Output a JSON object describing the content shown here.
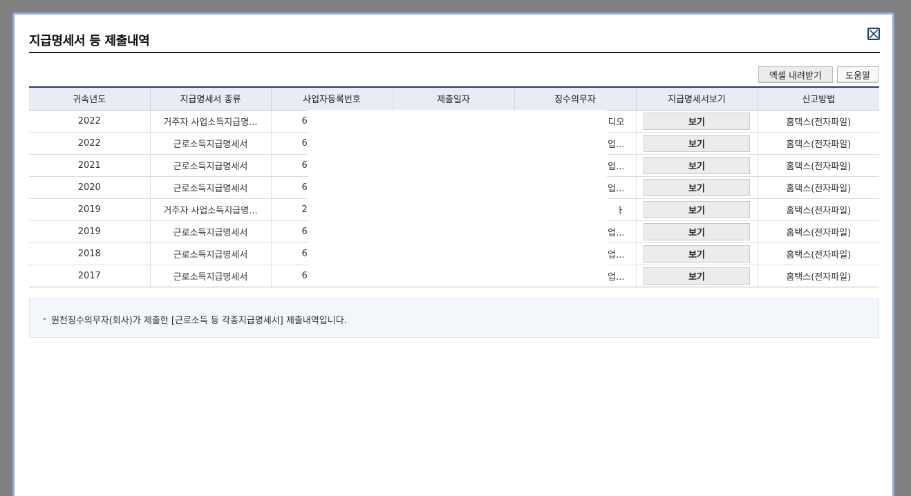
{
  "dialog": {
    "title": "지급명세서 등 제출내역",
    "excel_button": "엑셀 내려받기",
    "help_button": "도움말"
  },
  "table": {
    "headers": [
      "귀속년도",
      "지급명세서 종류",
      "사업자등록번호",
      "제출일자",
      "징수의무자",
      "지급명세서보기",
      "신고방법"
    ],
    "rows": [
      {
        "year": "2022",
        "type": "거주자 사업소득지급명...",
        "bizno": "6",
        "date": "",
        "payer": "디오",
        "view": "보기",
        "method": "홈택스(전자파일)"
      },
      {
        "year": "2022",
        "type": "근로소득지급명세서",
        "bizno": "6",
        "date": "",
        "payer": "업...",
        "view": "보기",
        "method": "홈택스(전자파일)"
      },
      {
        "year": "2021",
        "type": "근로소득지급명세서",
        "bizno": "6",
        "date": "",
        "payer": "업...",
        "view": "보기",
        "method": "홈택스(전자파일)"
      },
      {
        "year": "2020",
        "type": "근로소득지급명세서",
        "bizno": "6",
        "date": "",
        "payer": "업...",
        "view": "보기",
        "method": "홈택스(전자파일)"
      },
      {
        "year": "2019",
        "type": "거주자 사업소득지급명...",
        "bizno": "2",
        "date": "",
        "payer": "ㅏ",
        "view": "보기",
        "method": "홈택스(전자파일)"
      },
      {
        "year": "2019",
        "type": "근로소득지급명세서",
        "bizno": "6",
        "date": "",
        "payer": "업...",
        "view": "보기",
        "method": "홈택스(전자파일)"
      },
      {
        "year": "2018",
        "type": "근로소득지급명세서",
        "bizno": "6",
        "date": "",
        "payer": "업...",
        "view": "보기",
        "method": "홈택스(전자파일)"
      },
      {
        "year": "2017",
        "type": "근로소득지급명세서",
        "bizno": "6",
        "date": "",
        "payer": "업...",
        "view": "보기",
        "method": "홈택스(전자파일)"
      }
    ]
  },
  "notice": {
    "text": "원천징수의무자(회사)가 제출한 [근로소득 등 각종지급명세서] 제출내역입니다."
  },
  "colors": {
    "accent_border": "#8fb0dc",
    "header_bg": "#e8edf5",
    "notice_bg": "#f3f7fc"
  },
  "icons": {
    "close": "close-x-box-icon"
  }
}
